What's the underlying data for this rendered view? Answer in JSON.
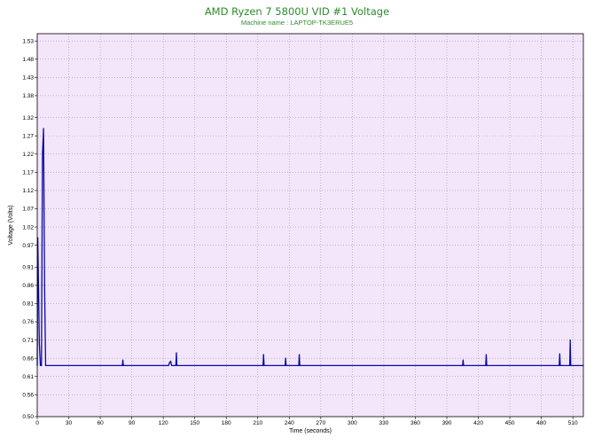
{
  "header": {
    "title": "AMD Ryzen 7 5800U VID #1 Voltage",
    "subtitle": "Machine name : LAPTOP-TK3ERUE5"
  },
  "colors": {
    "plot_background": "#f3e6fb",
    "grid": "#8c8c8c",
    "line": "#0a0aa0",
    "title": "#2e8b2e"
  },
  "chart_data": {
    "type": "line",
    "title": "AMD Ryzen 7 5800U VID #1 Voltage",
    "subtitle": "Machine name : LAPTOP-TK3ERUE5",
    "xlabel": "Time (seconds)",
    "ylabel": "Voltage (Volts)",
    "xlim": [
      0,
      520
    ],
    "ylim": [
      0.5,
      1.55
    ],
    "grid": true,
    "legend": "none",
    "x_ticks": [
      0,
      30,
      60,
      90,
      120,
      150,
      180,
      210,
      240,
      270,
      300,
      330,
      360,
      390,
      420,
      450,
      480,
      510
    ],
    "y_ticks": [
      "0.50",
      "0.56",
      "0.61",
      "0.66",
      "0.71",
      "0.76",
      "0.81",
      "0.86",
      "0.91",
      "0.97",
      "1.02",
      "1.07",
      "1.12",
      "1.17",
      "1.22",
      "1.27",
      "1.32",
      "1.38",
      "1.43",
      "1.48",
      "1.53"
    ],
    "series": [
      {
        "values_x": [
          0,
          0.5,
          1,
          2,
          3,
          4,
          5,
          6,
          7,
          8,
          81,
          81.5,
          82,
          125,
          126,
          127,
          128,
          132,
          132.5,
          133,
          215,
          215.5,
          216,
          236,
          236.5,
          237,
          249,
          249.5,
          250,
          405,
          405.5,
          406,
          427,
          427.5,
          428,
          497,
          497.5,
          498,
          507,
          507.5,
          508,
          520
        ],
        "values_y": [
          0.64,
          0.99,
          0.9,
          0.7,
          0.64,
          0.64,
          1.22,
          1.29,
          0.86,
          0.64,
          0.64,
          0.655,
          0.64,
          0.64,
          0.648,
          0.652,
          0.64,
          0.64,
          0.675,
          0.64,
          0.64,
          0.67,
          0.64,
          0.64,
          0.66,
          0.64,
          0.64,
          0.67,
          0.64,
          0.64,
          0.655,
          0.64,
          0.64,
          0.67,
          0.64,
          0.64,
          0.672,
          0.64,
          0.64,
          0.71,
          0.64,
          0.64
        ]
      }
    ]
  }
}
